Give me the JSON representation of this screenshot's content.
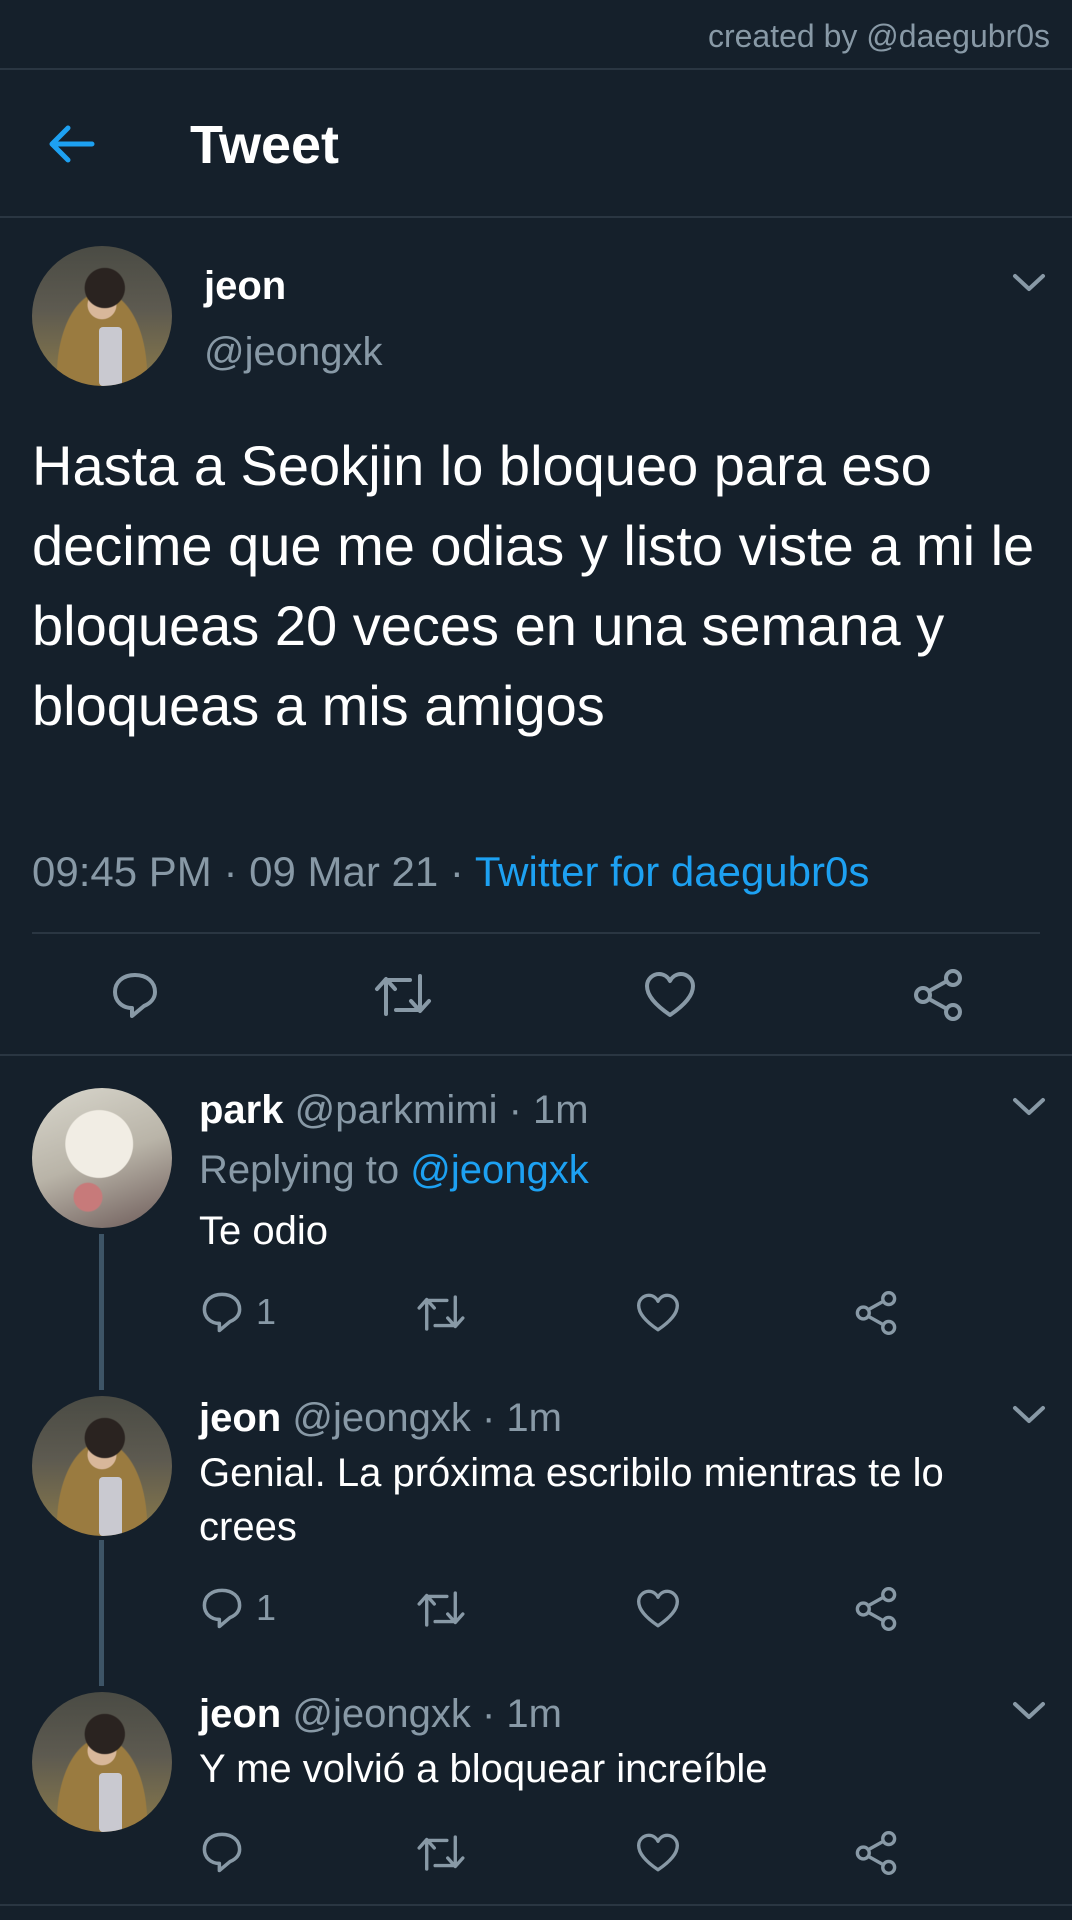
{
  "credit": "created by @daegubr0s",
  "header": {
    "title": "Tweet"
  },
  "main_tweet": {
    "name": "jeon",
    "handle": "@jeongxk",
    "text": "Hasta a Seokjin lo bloqueo para eso decime que me odias y listo viste a mi le bloqueas 20 veces en una semana y bloqueas a mis amigos",
    "time": "09:45 PM",
    "date": "09 Mar 21",
    "separator": "·",
    "source": "Twitter for daegubr0s"
  },
  "icons": {
    "back": "arrow-left-icon",
    "reply": "reply-icon",
    "retweet": "retweet-icon",
    "like": "heart-icon",
    "share": "share-icon",
    "more": "chevron-down-icon"
  },
  "colors": {
    "background": "#15202b",
    "accent": "#1da1f2",
    "muted": "#8899a6",
    "divider": "#2a3642"
  },
  "replies": [
    {
      "name": "park",
      "handle": "@parkmimi",
      "time": "1m",
      "replying_label": "Replying to",
      "replying_to": "@jeongxk",
      "text": "Te odio",
      "reply_count": "1"
    },
    {
      "name": "jeon",
      "handle": "@jeongxk",
      "time": "1m",
      "text": "Genial. La próxima escribilo mientras te lo crees",
      "reply_count": "1"
    },
    {
      "name": "jeon",
      "handle": "@jeongxk",
      "time": "1m",
      "text": "Y me volvió a bloquear increíble",
      "reply_count": ""
    }
  ]
}
